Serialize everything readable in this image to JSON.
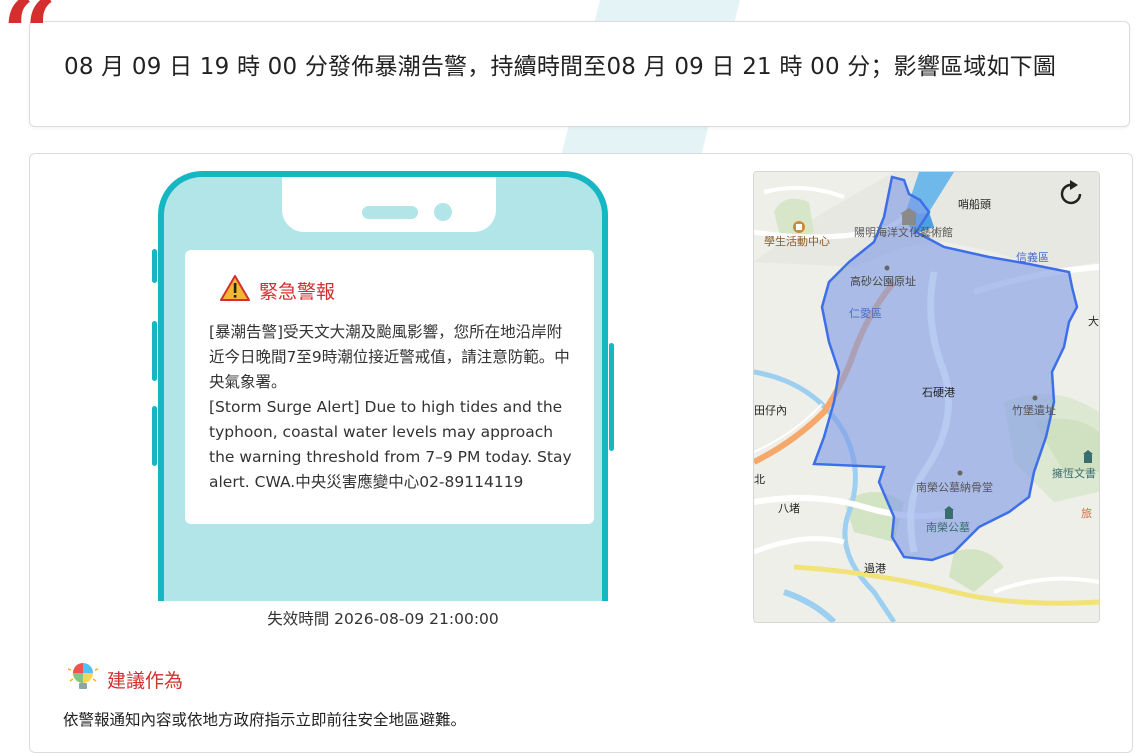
{
  "headline": "08 月 09 日 19 時 00 分發佈暴潮告警，持續時間至08 月 09 日 21 時 00 分；影響區域如下圖",
  "quote_mark": "“",
  "alert": {
    "title": "緊急警報",
    "body_zh": "[暴潮告警]受天文大潮及颱風影響，您所在地沿岸附近今日晚間7至9時潮位接近警戒值，請注意防範。中央氣象署。",
    "body_en": "[Storm Surge Alert] Due to high tides and the typhoon, coastal water levels may approach the warning threshold from 7–9 PM today. Stay alert. CWA.中央災害應變中心02-89114119"
  },
  "expiry": "失效時間 2026-08-09 21:00:00",
  "suggestion": {
    "title": "建議作為",
    "text": "依警報通知內容或依地方政府指示立即前往安全地區避難。"
  },
  "map": {
    "labels": {
      "shaochuantou": "哨船頭",
      "student_center": "學生活動中心",
      "museum": "陽明海洋文化藝術館",
      "xinyi": "信義區",
      "gaosha_park": "高砂公園原址",
      "renai": "仁愛區",
      "da": "大",
      "zaizainei": "田仔內",
      "shiyinggang": "石硬港",
      "zhubaoyizhi": "竹堡遺址",
      "bei": "北",
      "nanrong_ossuary": "南榮公墓納骨堂",
      "bazhu": "八堵",
      "nanrong_cemetery": "南榮公墓",
      "yonghengwen": "擁恆文書",
      "lu": "旅",
      "guogang": "過港"
    },
    "icons": [
      "refresh-icon",
      "museum-icon",
      "student-center-icon",
      "cemetery-icon",
      "school-icon"
    ],
    "colors": {
      "alert_area": "#7f9be6",
      "alert_border": "#3d6fe8",
      "river": "#9ccff0",
      "road": "#f5a86a"
    }
  },
  "colors": {
    "accent": "#d32f2f",
    "phone": "#16b7c2",
    "phone_screen": "#b2e5e8"
  }
}
